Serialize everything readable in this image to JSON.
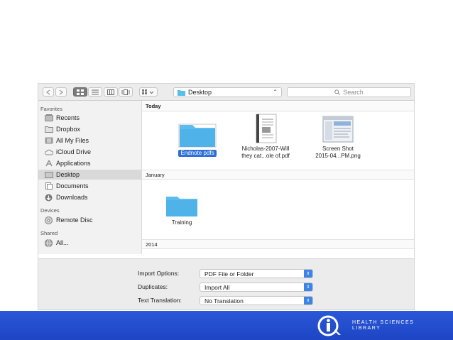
{
  "toolbar": {
    "location": "Desktop",
    "search_placeholder": "Search"
  },
  "sidebar": {
    "sections": [
      {
        "label": "Favorites"
      },
      {
        "label": "Devices"
      },
      {
        "label": "Shared"
      }
    ],
    "items": [
      {
        "label": "Recents",
        "icon": "recents-icon"
      },
      {
        "label": "Dropbox",
        "icon": "folder-icon"
      },
      {
        "label": "All My Files",
        "icon": "all-files-icon"
      },
      {
        "label": "iCloud Drive",
        "icon": "cloud-icon"
      },
      {
        "label": "Applications",
        "icon": "applications-icon"
      },
      {
        "label": "Desktop",
        "icon": "desktop-icon",
        "selected": true
      },
      {
        "label": "Documents",
        "icon": "documents-icon"
      },
      {
        "label": "Downloads",
        "icon": "downloads-icon"
      },
      {
        "label": "Remote Disc",
        "icon": "disc-icon"
      },
      {
        "label": "All...",
        "icon": "network-icon"
      }
    ]
  },
  "main": {
    "groups": [
      {
        "label": "Today"
      },
      {
        "label": "January"
      },
      {
        "label": "2014"
      }
    ],
    "files": [
      {
        "name": "Endnote pdfs",
        "kind": "folder",
        "selected": true
      },
      {
        "name_line1": "Nicholas-2007-Will",
        "name_line2": "they cat...ole of.pdf",
        "kind": "pdf"
      },
      {
        "name_line1": "Screen Shot",
        "name_line2": "2015-04...PM.png",
        "kind": "png"
      },
      {
        "name": "Training",
        "kind": "folder"
      }
    ]
  },
  "options": {
    "import_options": {
      "label": "Import Options:",
      "value": "PDF File or Folder"
    },
    "duplicates": {
      "label": "Duplicates:",
      "value": "Import All"
    },
    "text_translation": {
      "label": "Text Translation:",
      "value": "No Translation"
    }
  },
  "footer": {
    "logo_line1": "HEALTH SCIENCES",
    "logo_line2": "LIBRARY"
  },
  "colors": {
    "footer": "#2150d0",
    "folder": "#5bbcf0",
    "selection": "#2f6fd6",
    "stepper": "#3d84e6"
  }
}
